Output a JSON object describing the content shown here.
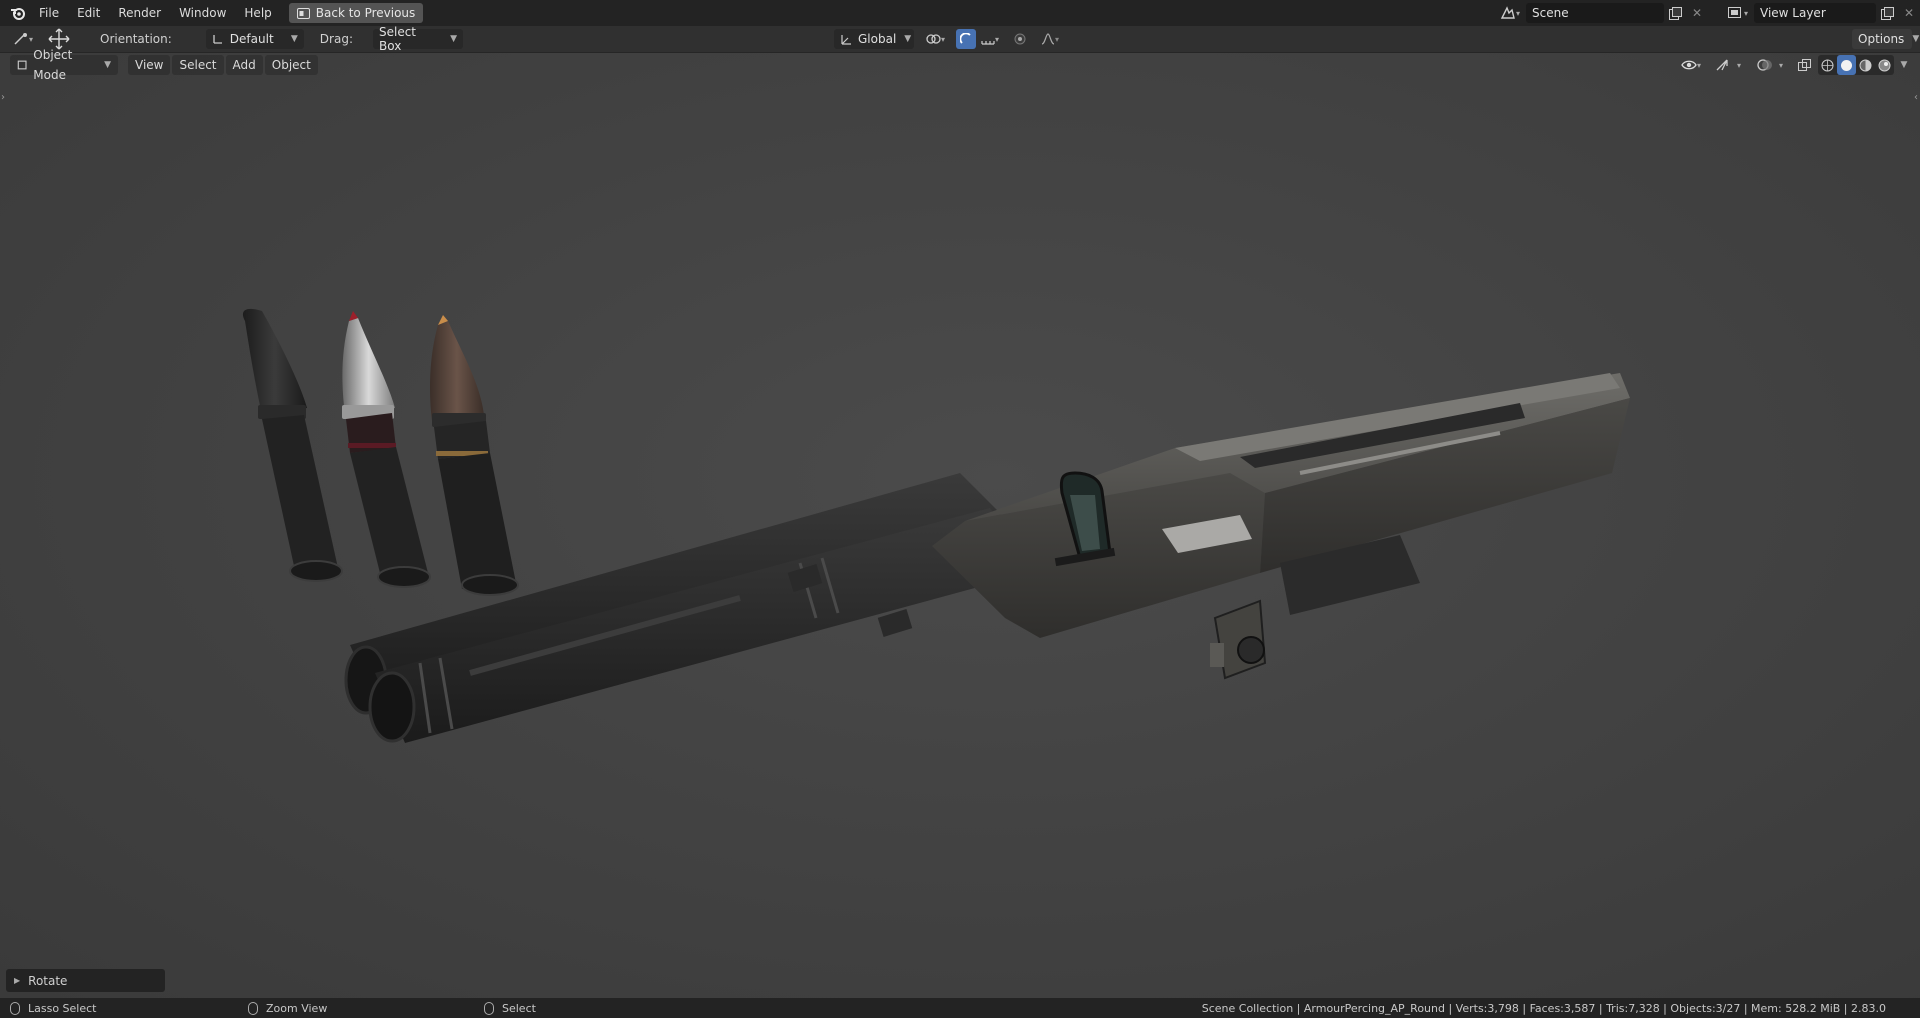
{
  "menu": {
    "items": [
      "File",
      "Edit",
      "Render",
      "Window",
      "Help"
    ],
    "back_button": "Back to Previous"
  },
  "workspace": {
    "scene": "Scene",
    "view_layer": "View Layer"
  },
  "toolbar": {
    "orientation_label": "Orientation:",
    "orientation_value": "Default",
    "drag_label": "Drag:",
    "drag_value": "Select Box",
    "transform_orientation": "Global",
    "options": "Options"
  },
  "viewport_header": {
    "mode": "Object Mode",
    "menus": [
      "View",
      "Select",
      "Add",
      "Object"
    ]
  },
  "operator_panel": {
    "label": "Rotate"
  },
  "statusbar": {
    "left_hint": "Lasso Select",
    "middle_hint": "Zoom View",
    "right_hint": "Select",
    "stats": "Scene Collection | ArmourPercing_AP_Round | Verts:3,798 | Faces:3,587 | Tris:7,328 | Objects:3/27 | Mem: 528.2 MiB | 2.83.0"
  },
  "icons": {
    "logo": "blender-logo-icon",
    "back": "back-window-icon",
    "scene": "scene-icon",
    "view_layer": "view-layer-icon"
  },
  "colors": {
    "accent": "#4772b3",
    "viewport_bg": "#444444",
    "header_bg": "#303030",
    "topbar_bg": "#232323"
  }
}
